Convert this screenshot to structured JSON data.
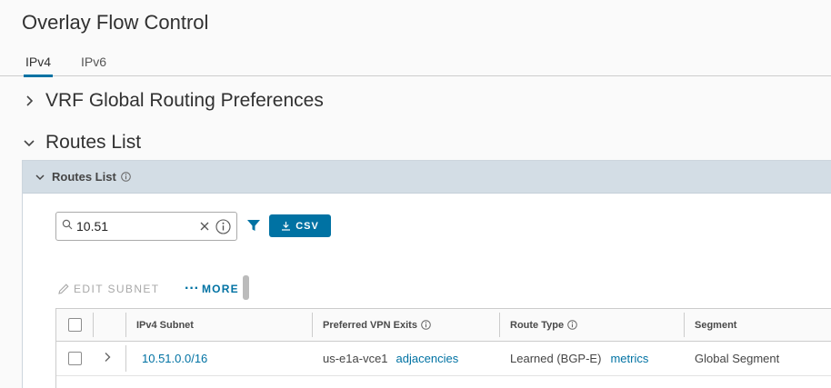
{
  "page": {
    "title": "Overlay Flow Control"
  },
  "tabs": [
    {
      "label": "IPv4",
      "active": true
    },
    {
      "label": "IPv6",
      "active": false
    }
  ],
  "sections": {
    "vrf": {
      "title": "VRF Global Routing Preferences",
      "expanded": false
    },
    "routes": {
      "title": "Routes List",
      "expanded": true
    }
  },
  "routes_card": {
    "header": "Routes List",
    "search": {
      "value": "10.51",
      "placeholder": ""
    },
    "csv_label": "CSV",
    "actions": {
      "edit_subnet": "EDIT SUBNET",
      "more": "MORE"
    },
    "columns": {
      "ipv4_subnet": "IPv4 Subnet",
      "preferred_vpn_exits": "Preferred VPN Exits",
      "route_type": "Route Type",
      "segment": "Segment"
    },
    "rows": [
      {
        "subnet": "10.51.0.0/16",
        "vpn_exit": "us-e1a-vce1",
        "vpn_exit_link": "adjacencies",
        "route_type": "Learned (BGP-E)",
        "route_type_link": "metrics",
        "segment": "Global Segment"
      }
    ]
  },
  "colors": {
    "accent": "#0072a3",
    "card_header": "#d3dde5"
  },
  "icons": {
    "section_collapsed": "chevron-right-icon",
    "section_expanded": "chevron-down-icon",
    "search": "search-icon",
    "clear": "close-icon",
    "info": "info-circle-icon",
    "filter": "filter-icon",
    "download": "download-icon",
    "edit": "pencil-icon",
    "more": "ellipsis-icon"
  }
}
